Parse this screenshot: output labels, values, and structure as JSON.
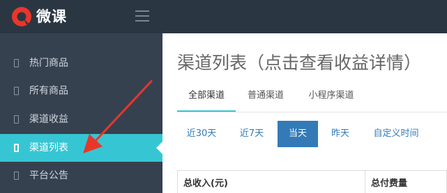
{
  "header": {
    "brand": "微课",
    "logo_icon": "logo-icon",
    "menu_icon": "hamburger-icon"
  },
  "sidebar": {
    "items": [
      {
        "label": "热门商品",
        "icon": "item-icon",
        "active": false
      },
      {
        "label": "所有商品",
        "icon": "item-icon",
        "active": false
      },
      {
        "label": "渠道收益",
        "icon": "item-icon",
        "active": false
      },
      {
        "label": "渠道列表",
        "icon": "item-icon",
        "active": true
      },
      {
        "label": "平台公告",
        "icon": "item-icon",
        "active": false
      }
    ]
  },
  "main": {
    "title": "渠道列表（点击查看收益详情）",
    "tabs": [
      {
        "label": "全部渠道",
        "active": true
      },
      {
        "label": "普通渠道",
        "active": false
      },
      {
        "label": "小程序渠道",
        "active": false
      }
    ],
    "ranges": [
      {
        "label": "近30天",
        "active": false
      },
      {
        "label": "近7天",
        "active": false
      },
      {
        "label": "当天",
        "active": true
      },
      {
        "label": "昨天",
        "active": false
      },
      {
        "label": "自定义时间",
        "active": false
      }
    ],
    "table": {
      "columns": [
        "总收入(元)",
        "总付费量"
      ]
    }
  },
  "colors": {
    "header_bg": "#2b3643",
    "sidebar_bg": "#364150",
    "active_accent": "#36c6d3",
    "button_blue": "#337ab7",
    "annotation_red": "#e8362b"
  }
}
